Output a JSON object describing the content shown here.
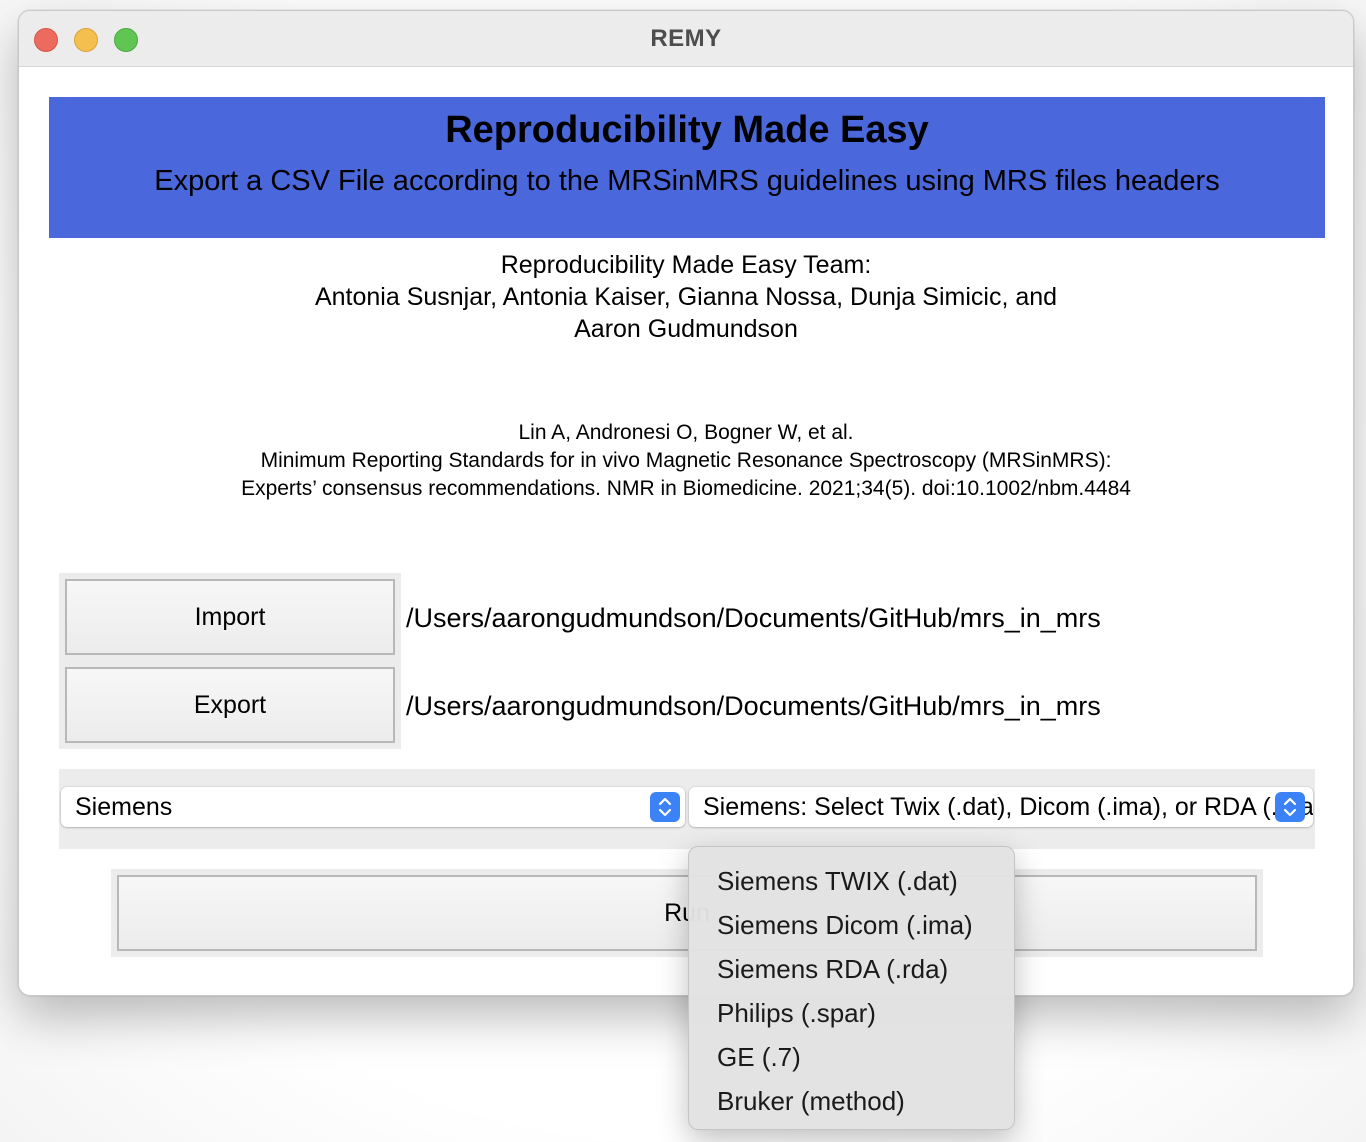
{
  "window": {
    "title": "REMY"
  },
  "banner": {
    "title": "Reproducibility Made Easy",
    "subtitle": "Export a CSV File according to the MRSinMRS guidelines using MRS files headers"
  },
  "team": {
    "line1": "Reproducibility Made Easy Team:",
    "line2": "Antonia Susnjar, Antonia Kaiser, Gianna Nossa, Dunja Simicic, and",
    "line3": "Aaron Gudmundson"
  },
  "citation": {
    "line1": "Lin A, Andronesi O, Bogner W, et al.",
    "line2": "Minimum Reporting Standards for in vivo Magnetic Resonance Spectroscopy (MRSinMRS):",
    "line3": "Experts’ consensus recommendations. NMR in Biomedicine. 2021;34(5). doi:10.1002/nbm.4484"
  },
  "import": {
    "button_label": "Import",
    "path": "/Users/aarongudmundson/Documents/GitHub/mrs_in_mrs"
  },
  "export": {
    "button_label": "Export",
    "path": "/Users/aarongudmundson/Documents/GitHub/mrs_in_mrs"
  },
  "vendor_select": {
    "value": "Siemens"
  },
  "filetype_select": {
    "value": "Siemens: Select Twix (.dat), Dicom (.ima), or RDA (.rda)"
  },
  "run": {
    "label": "Run"
  },
  "dropdown": {
    "options": [
      "Siemens TWIX (.dat)",
      "Siemens Dicom (.ima)",
      "Siemens RDA (.rda)",
      "Philips (.spar)",
      "GE (.7)",
      "Bruker (method)"
    ]
  },
  "colors": {
    "banner": "#4a67dc",
    "stepper": "#3b82f6",
    "close": "#ed6a5e",
    "minimize": "#f5bf4f",
    "maximize": "#61c554"
  }
}
